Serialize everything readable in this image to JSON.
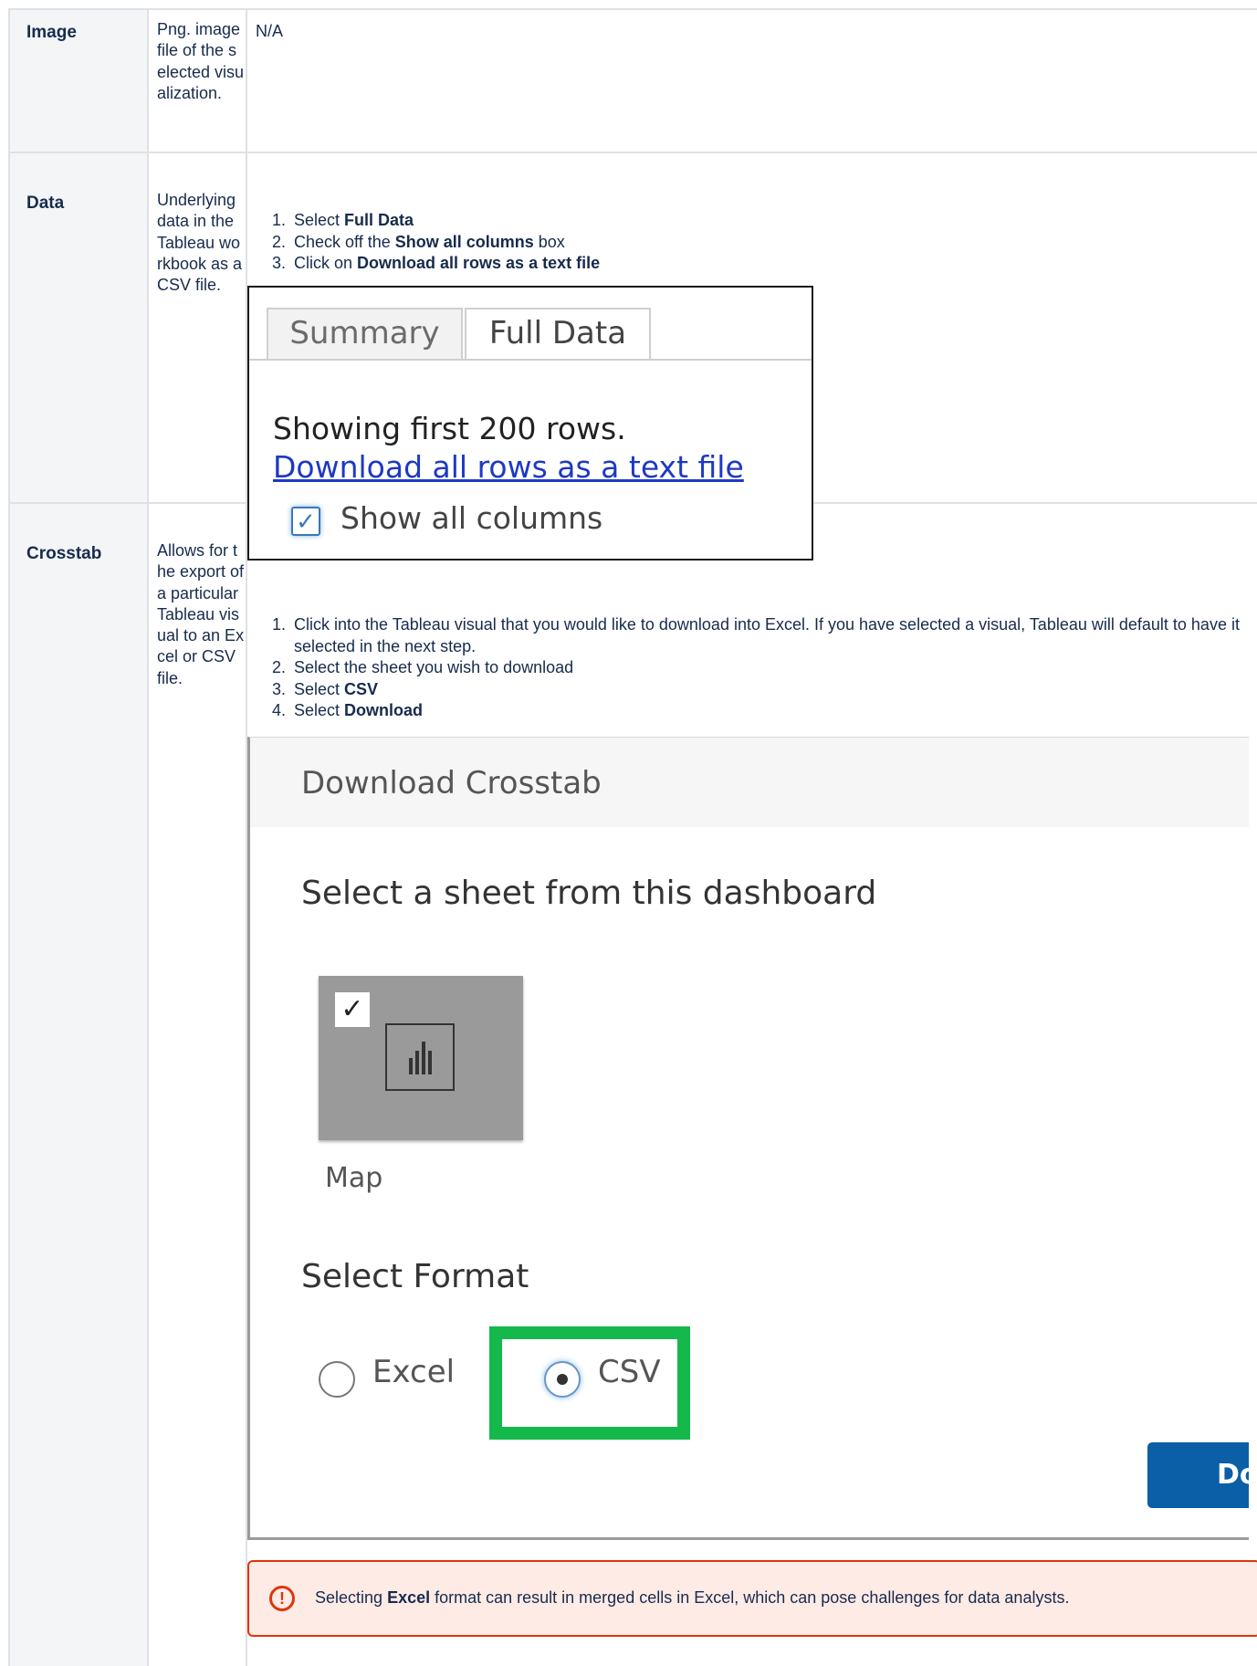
{
  "rows": [
    {
      "name": "Image",
      "description": "Png. image file of the selected visualization.",
      "details": "N/A"
    },
    {
      "name": "Data",
      "description": "Underlying data in the Tableau workbook as a CSV file.",
      "steps": [
        {
          "pre": "Select ",
          "bold": "Full Data",
          "post": ""
        },
        {
          "pre": "Check off the ",
          "bold": "Show all columns",
          "post": " box"
        },
        {
          "pre": "Click on ",
          "bold": "Download all rows as a text file",
          "post": ""
        }
      ],
      "screenshot": {
        "tab_summary": "Summary",
        "tab_full_data": "Full Data",
        "showing_text": "Showing first 200 rows.",
        "download_link": "Download all rows as a text file",
        "checkbox_label": "Show all columns",
        "checkbox_checked": true
      }
    },
    {
      "name": "Crosstab",
      "description": "Allows for the export of a particular Tableau visual to an Excel or CSV file.",
      "steps": [
        {
          "pre": "Click into the Tableau visual that you would like to download into Excel. If you have selected a visual, Tableau will default to have it selected in the next step.",
          "bold": "",
          "post": ""
        },
        {
          "pre": "Select the sheet you wish to download",
          "bold": "",
          "post": ""
        },
        {
          "pre": "Select ",
          "bold": "CSV",
          "post": ""
        },
        {
          "pre": "Select ",
          "bold": "Download",
          "post": ""
        }
      ],
      "dialog": {
        "title": "Download Crosstab",
        "sheet_prompt": "Select a sheet from this dashboard",
        "sheet_name": "Map",
        "sheet_checked": true,
        "format_prompt": "Select Format",
        "format_options": [
          "Excel",
          "CSV"
        ],
        "selected_format": "CSV",
        "download_button": "Download",
        "highlight_color": "#15b84b"
      },
      "warning": {
        "pre": "Selecting ",
        "bold": "Excel",
        "post": " format can result in merged cells in Excel, which can pose challenges for data analysts."
      }
    }
  ],
  "colors": {
    "border": "#dfe1e6",
    "header_bg": "#f4f5f7",
    "warning_border": "#de350b",
    "warning_bg": "#ffebe6",
    "link": "#1d39c4",
    "button": "#0a5fa6"
  }
}
